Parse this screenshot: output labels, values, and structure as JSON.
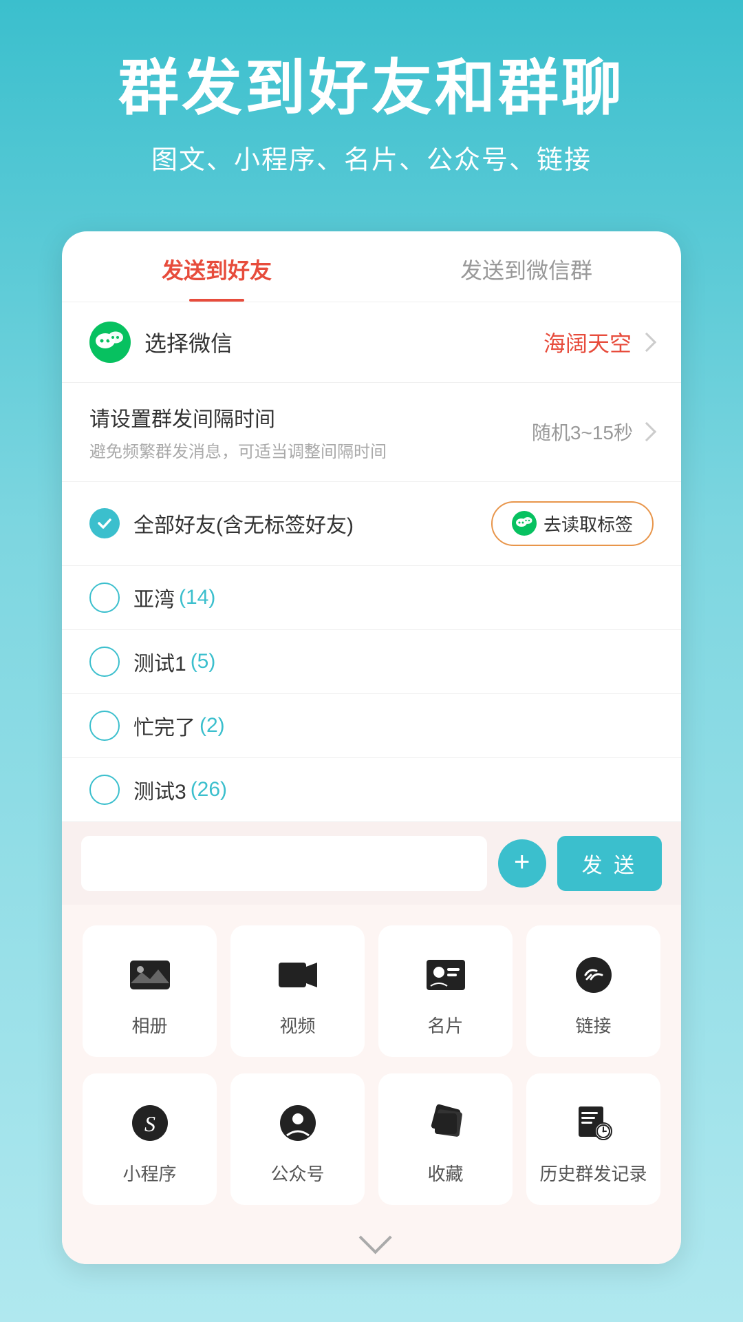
{
  "header": {
    "main_title": "群发到好友和群聊",
    "subtitle": "图文、小程序、名片、公众号、链接"
  },
  "tabs": {
    "tab1_label": "发送到好友",
    "tab2_label": "发送到微信群"
  },
  "wechat_row": {
    "label": "选择微信",
    "value": "海阔天空"
  },
  "interval_row": {
    "title": "请设置群发间隔时间",
    "hint": "避免频繁群发消息，可适当调整间隔时间",
    "value": "随机3~15秒"
  },
  "friends_row": {
    "label": "全部好友(含无标签好友)",
    "btn_label": "去读取标签"
  },
  "tag_list": [
    {
      "name": "亚湾",
      "count": "(14)"
    },
    {
      "name": "测试1",
      "count": "(5)"
    },
    {
      "name": "忙完了",
      "count": "(2)"
    },
    {
      "name": "测试3",
      "count": "(26)"
    }
  ],
  "input_area": {
    "placeholder": "",
    "plus_label": "+",
    "send_label": "发 送"
  },
  "action_grid": {
    "row1": [
      {
        "id": "album",
        "label": "相册"
      },
      {
        "id": "video",
        "label": "视频"
      },
      {
        "id": "card",
        "label": "名片"
      },
      {
        "id": "link",
        "label": "链接"
      }
    ],
    "row2": [
      {
        "id": "miniapp",
        "label": "小程序"
      },
      {
        "id": "official",
        "label": "公众号"
      },
      {
        "id": "collect",
        "label": "收藏"
      },
      {
        "id": "history",
        "label": "历史群发记录"
      }
    ]
  }
}
